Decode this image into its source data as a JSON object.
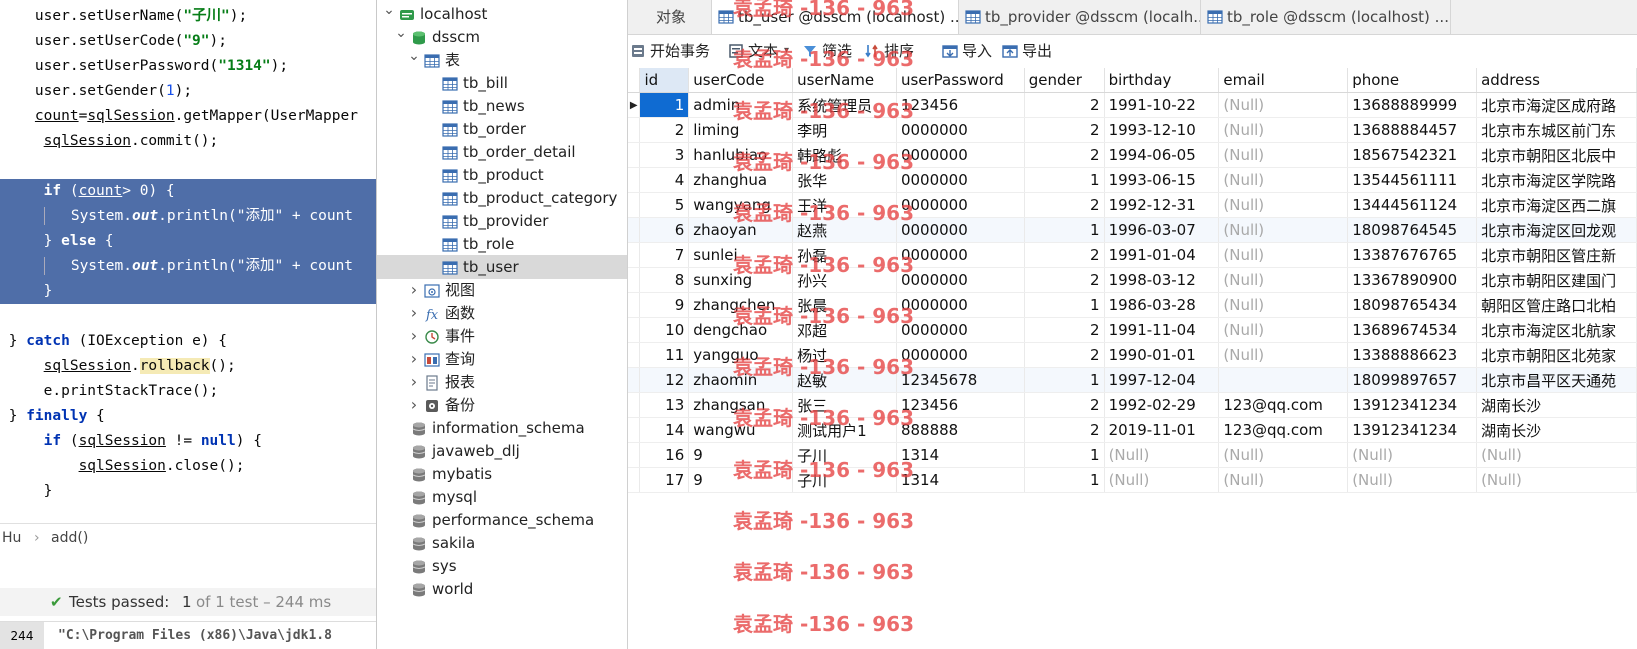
{
  "ide": {
    "code_lines": [
      {
        "html": "    user.setUserName(<span class=\"str\">\"子川\"</span>);",
        "sel": false
      },
      {
        "html": "    user.setUserCode(<span class=\"str\">\"9\"</span>);",
        "sel": false
      },
      {
        "html": "    user.setUserPassword(<span class=\"str\">\"1314\"</span>);",
        "sel": false
      },
      {
        "html": "    user.setGender(<span class=\"num\">1</span>);",
        "sel": false
      },
      {
        "html": "    <span class=\"ul\">count</span>=<span class=\"ul\">sqlSession</span>.getMapper(UserMapper",
        "sel": false
      },
      {
        "html": "     <span class=\"ul\">sqlSession</span>.commit();",
        "sel": false
      },
      {
        "html": "",
        "sel": false
      },
      {
        "html": "     <span class=\"kw\">if</span> (<span class=\"ul\">count</span>&gt; <span class=\"num\">0</span>) {",
        "sel": true
      },
      {
        "html": "     <span class=\"bar\"></span>   System.<span class=\"it\">out</span>.println(\"添加\" + count",
        "sel": true
      },
      {
        "html": "     } <span class=\"kw\">else</span> {",
        "sel": true
      },
      {
        "html": "     <span class=\"bar\"></span>   System.<span class=\"it\">out</span>.println(\"添加\" + count",
        "sel": true
      },
      {
        "html": "     }",
        "sel": true
      },
      {
        "html": "",
        "sel": false
      },
      {
        "html": " } <span class=\"kw\">catch</span> (IOException e) {",
        "sel": false
      },
      {
        "html": "     <span class=\"ul\">sqlSession</span>.<span class=\"hl\">rollback</span>();",
        "sel": false
      },
      {
        "html": "     e.printStackTrace();",
        "sel": false
      },
      {
        "html": " } <span class=\"kw\">finally</span> {",
        "sel": false
      },
      {
        "html": "     <span class=\"kw\">if</span> (<span class=\"ul\">sqlSession</span> != <span class=\"kw\">null</span>) {",
        "sel": false
      },
      {
        "html": "         <span class=\"ul\">sqlSession</span>.close();",
        "sel": false
      },
      {
        "html": "     }",
        "sel": false
      }
    ],
    "breadcrumb": {
      "class": "Hu",
      "sep": "›",
      "method": "add()"
    },
    "tests": {
      "prefix": "Tests passed:",
      "count": "1",
      "suffix": "of 1 test – 244 ms"
    },
    "run": {
      "time": "244 ms",
      "cmd": "\"C:\\Program Files (x86)\\Java\\jdk1.8"
    }
  },
  "navigator": {
    "items": [
      {
        "label": "localhost",
        "level": 0,
        "icon": "connection",
        "arrow": "down"
      },
      {
        "label": "dsscm",
        "level": 1,
        "icon": "database-open",
        "arrow": "down"
      },
      {
        "label": "表",
        "level": 2,
        "icon": "tables-folder",
        "arrow": "down"
      },
      {
        "label": "tb_bill",
        "level": 3,
        "icon": "table",
        "arrow": ""
      },
      {
        "label": "tb_news",
        "level": 3,
        "icon": "table",
        "arrow": ""
      },
      {
        "label": "tb_order",
        "level": 3,
        "icon": "table",
        "arrow": ""
      },
      {
        "label": "tb_order_detail",
        "level": 3,
        "icon": "table",
        "arrow": ""
      },
      {
        "label": "tb_product",
        "level": 3,
        "icon": "table",
        "arrow": ""
      },
      {
        "label": "tb_product_category",
        "level": 3,
        "icon": "table",
        "arrow": ""
      },
      {
        "label": "tb_provider",
        "level": 3,
        "icon": "table",
        "arrow": ""
      },
      {
        "label": "tb_role",
        "level": 3,
        "icon": "table",
        "arrow": ""
      },
      {
        "label": "tb_user",
        "level": 3,
        "icon": "table",
        "arrow": "",
        "selected": true
      },
      {
        "label": "视图",
        "level": 2,
        "icon": "view",
        "arrow": "right"
      },
      {
        "label": "函数",
        "level": 2,
        "icon": "function",
        "arrow": "right"
      },
      {
        "label": "事件",
        "level": 2,
        "icon": "event",
        "arrow": "right"
      },
      {
        "label": "查询",
        "level": 2,
        "icon": "query",
        "arrow": "right"
      },
      {
        "label": "报表",
        "level": 2,
        "icon": "report",
        "arrow": "right"
      },
      {
        "label": "备份",
        "level": 2,
        "icon": "backup",
        "arrow": "right"
      },
      {
        "label": "information_schema",
        "level": 1,
        "icon": "database",
        "arrow": ""
      },
      {
        "label": "javaweb_dlj",
        "level": 1,
        "icon": "database",
        "arrow": ""
      },
      {
        "label": "mybatis",
        "level": 1,
        "icon": "database",
        "arrow": ""
      },
      {
        "label": "mysql",
        "level": 1,
        "icon": "database",
        "arrow": ""
      },
      {
        "label": "performance_schema",
        "level": 1,
        "icon": "database",
        "arrow": ""
      },
      {
        "label": "sakila",
        "level": 1,
        "icon": "database",
        "arrow": ""
      },
      {
        "label": "sys",
        "level": 1,
        "icon": "database",
        "arrow": ""
      },
      {
        "label": "world",
        "level": 1,
        "icon": "database",
        "arrow": ""
      }
    ]
  },
  "tabs": [
    {
      "label": "对象",
      "active": false,
      "icon": false
    },
    {
      "label": "tb_user @dsscm (localhost) ...",
      "active": true,
      "icon": true
    },
    {
      "label": "tb_provider @dsscm (localh...",
      "active": false,
      "icon": true
    },
    {
      "label": "tb_role @dsscm (localhost) ...",
      "active": false,
      "icon": true
    }
  ],
  "toolbar": {
    "begin_transaction": "开始事务",
    "text": "文本",
    "filter": "筛选",
    "sort": "排序",
    "import": "导入",
    "export": "导出"
  },
  "table": {
    "columns": [
      "id",
      "userCode",
      "userName",
      "userPassword",
      "gender",
      "birthday",
      "email",
      "phone",
      "address"
    ],
    "rows": [
      [
        "1",
        "admin",
        "系统管理员",
        "123456",
        "2",
        "1991-10-22",
        "(Null)",
        "13688889999",
        "北京市海淀区成府路"
      ],
      [
        "2",
        "liming",
        "李明",
        "0000000",
        "2",
        "1993-12-10",
        "(Null)",
        "13688884457",
        "北京市东城区前门东"
      ],
      [
        "3",
        "hanlubiao",
        "韩路彪",
        "0000000",
        "2",
        "1994-06-05",
        "(Null)",
        "18567542321",
        "北京市朝阳区北辰中"
      ],
      [
        "4",
        "zhanghua",
        "张华",
        "0000000",
        "1",
        "1993-06-15",
        "(Null)",
        "13544561111",
        "北京市海淀区学院路"
      ],
      [
        "5",
        "wangyang",
        "王洋",
        "0000000",
        "2",
        "1992-12-31",
        "(Null)",
        "13444561124",
        "北京市海淀区西二旗"
      ],
      [
        "6",
        "zhaoyan",
        "赵燕",
        "0000000",
        "1",
        "1996-03-07",
        "(Null)",
        "18098764545",
        "北京市海淀区回龙观"
      ],
      [
        "7",
        "sunlei",
        "孙磊",
        "0000000",
        "2",
        "1991-01-04",
        "(Null)",
        "13387676765",
        "北京市朝阳区管庄新"
      ],
      [
        "8",
        "sunxing",
        "孙兴",
        "0000000",
        "2",
        "1998-03-12",
        "(Null)",
        "13367890900",
        "北京市朝阳区建国门"
      ],
      [
        "9",
        "zhangchen",
        "张晨",
        "0000000",
        "1",
        "1986-03-28",
        "(Null)",
        "18098765434",
        "朝阳区管庄路口北柏"
      ],
      [
        "10",
        "dengchao",
        "邓超",
        "0000000",
        "2",
        "1991-11-04",
        "(Null)",
        "13689674534",
        "北京市海淀区北航家"
      ],
      [
        "11",
        "yangguo",
        "杨过",
        "0000000",
        "2",
        "1990-01-01",
        "(Null)",
        "13388886623",
        "北京市朝阳区北苑家"
      ],
      [
        "12",
        "zhaomin",
        "赵敏",
        "12345678",
        "1",
        "1997-12-04",
        "",
        "18099897657",
        "北京市昌平区天通苑"
      ],
      [
        "13",
        "zhangsan",
        "张三",
        "123456",
        "2",
        "1992-02-29",
        "123@qq.com",
        "13912341234",
        "湖南长沙"
      ],
      [
        "14",
        "wangwu",
        "测试用户1",
        "888888",
        "2",
        "2019-11-01",
        "123@qq.com",
        "13912341234",
        "湖南长沙"
      ],
      [
        "16",
        "9",
        "子川",
        "1314",
        "1",
        "(Null)",
        "(Null)",
        "(Null)",
        "(Null)"
      ],
      [
        "17",
        "9",
        "子川",
        "1314",
        "1",
        "(Null)",
        "(Null)",
        "(Null)",
        "(Null)"
      ]
    ],
    "row_marker": "▶"
  },
  "watermark": "袁孟琦 -136 - 963",
  "colors": {
    "selection": "#4f6ea8",
    "current_cell": "#0f6bd2",
    "watermark": "#e64141",
    "test_pass": "#3a9a3a"
  }
}
